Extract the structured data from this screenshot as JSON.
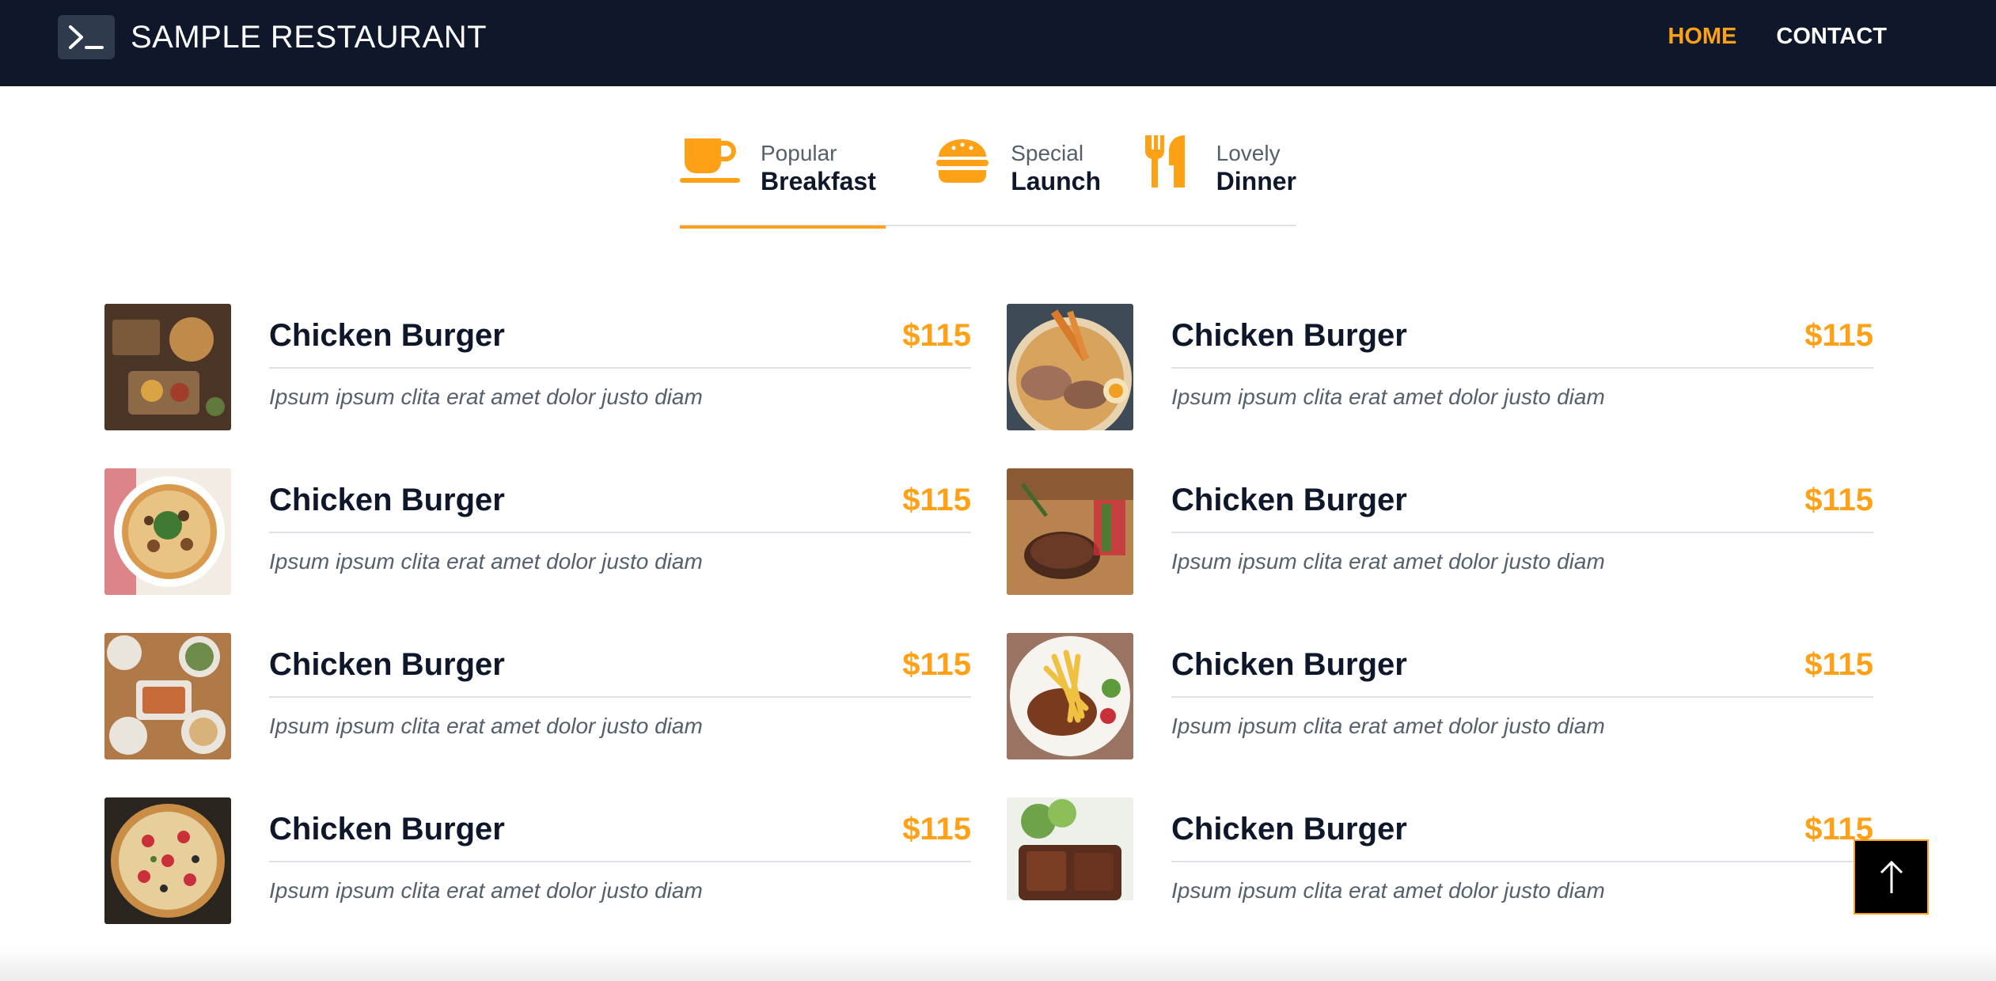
{
  "navbar": {
    "brand_title": "SAMPLE RESTAURANT",
    "links": [
      {
        "label": "HOME",
        "active": true
      },
      {
        "label": "CONTACT",
        "active": false
      }
    ]
  },
  "tabs": [
    {
      "sub": "Popular",
      "main": "Breakfast",
      "icon": "coffee-icon",
      "active": true
    },
    {
      "sub": "Special",
      "main": "Launch",
      "icon": "hamburger-icon",
      "active": false
    },
    {
      "sub": "Lovely",
      "main": "Dinner",
      "icon": "utensils-icon",
      "active": false
    }
  ],
  "menu": {
    "items": [
      {
        "name": "Chicken Burger",
        "price": "$115",
        "desc": "Ipsum ipsum clita erat amet dolor justo diam"
      },
      {
        "name": "Chicken Burger",
        "price": "$115",
        "desc": "Ipsum ipsum clita erat amet dolor justo diam"
      },
      {
        "name": "Chicken Burger",
        "price": "$115",
        "desc": "Ipsum ipsum clita erat amet dolor justo diam"
      },
      {
        "name": "Chicken Burger",
        "price": "$115",
        "desc": "Ipsum ipsum clita erat amet dolor justo diam"
      },
      {
        "name": "Chicken Burger",
        "price": "$115",
        "desc": "Ipsum ipsum clita erat amet dolor justo diam"
      },
      {
        "name": "Chicken Burger",
        "price": "$115",
        "desc": "Ipsum ipsum clita erat amet dolor justo diam"
      },
      {
        "name": "Chicken Burger",
        "price": "$115",
        "desc": "Ipsum ipsum clita erat amet dolor justo diam"
      },
      {
        "name": "Chicken Burger",
        "price": "$115",
        "desc": "Ipsum ipsum clita erat amet dolor justo diam"
      }
    ]
  },
  "colors": {
    "navbar_bg": "#0f172b",
    "accent": "#fea116",
    "text_dark": "#0f172b",
    "text_muted": "#555f6d"
  },
  "back_to_top": {
    "icon": "arrow-up-icon"
  }
}
